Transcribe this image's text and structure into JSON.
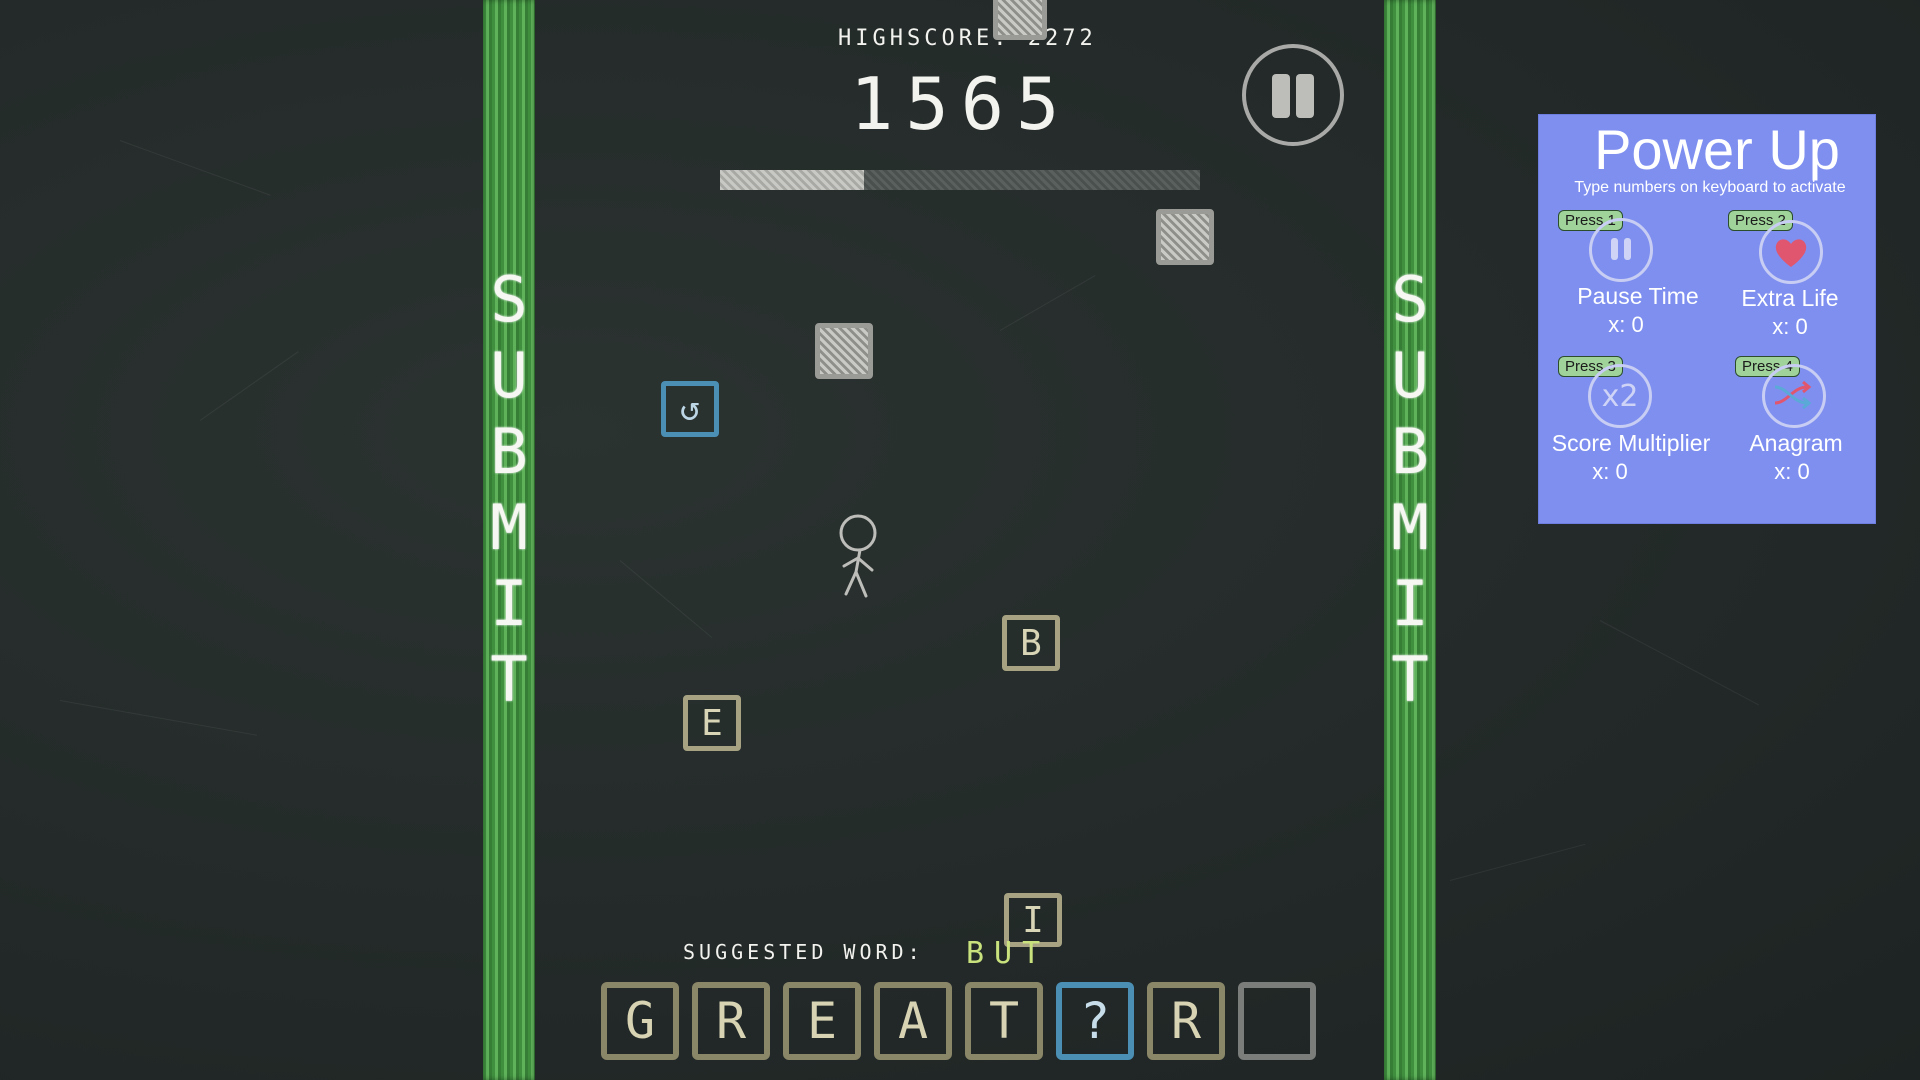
{
  "hud": {
    "highscore_label": "HIGHSCORE:",
    "highscore_value": "2272",
    "score": "1565",
    "progress_fraction": 0.3
  },
  "submit": {
    "left_letters": [
      "S",
      "U",
      "B",
      "M",
      "I",
      "T"
    ],
    "right_letters": [
      "S",
      "U",
      "B",
      "M",
      "I",
      "T"
    ]
  },
  "falling_tiles": {
    "b": "B",
    "e": "E",
    "i": "I"
  },
  "suggested": {
    "label": "SUGGESTED WORD:",
    "word": "BUT"
  },
  "word_slots": [
    "G",
    "R",
    "E",
    "A",
    "T",
    "?",
    "R",
    ""
  ],
  "powerups": {
    "title": "Power Up",
    "subtitle": "Type numbers on keyboard to activate",
    "items": [
      {
        "key": "Press 1",
        "name": "Pause Time",
        "count": "x: 0",
        "icon": "pause-icon"
      },
      {
        "key": "Press 2",
        "name": "Extra Life",
        "count": "x: 0",
        "icon": "heart-icon"
      },
      {
        "key": "Press 3",
        "name": "Score Multiplier",
        "count": "x: 0",
        "icon": "x2-icon",
        "icon_text": "x2"
      },
      {
        "key": "Press 4",
        "name": "Anagram",
        "count": "x: 0",
        "icon": "shuffle-icon"
      }
    ]
  },
  "colors": {
    "chalkboard": "#232a29",
    "submit_green": "#4f9f4b",
    "panel": "#7e8ff0",
    "suggest": "#c9e27d",
    "blue_tile": "#4b8fb5",
    "heart": "#e0566f"
  }
}
